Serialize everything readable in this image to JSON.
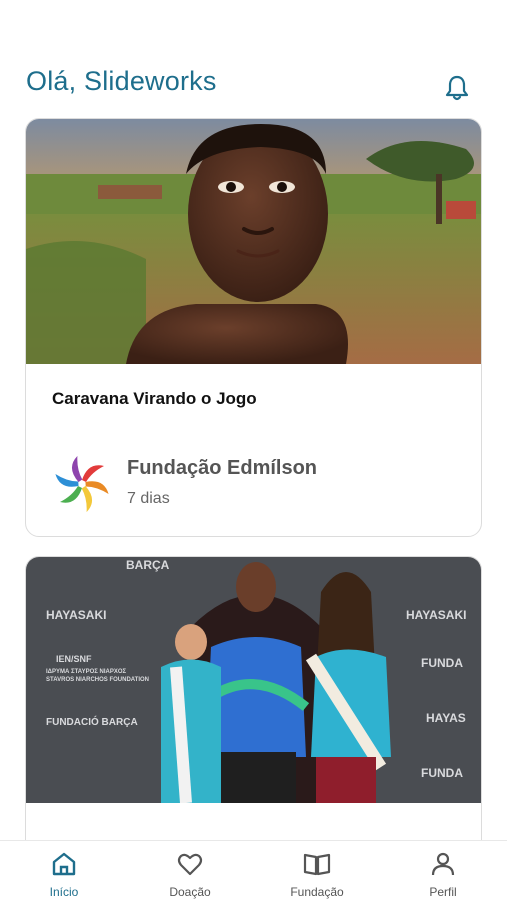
{
  "header": {
    "greeting": "Olá, Slideworks",
    "bell_icon": "bell-icon"
  },
  "feed": {
    "cards": [
      {
        "title": "Caravana Virando o Jogo",
        "organization": "Fundação Edmílson",
        "time_ago": "7 dias",
        "image": "photo-of-child-in-rural-field"
      },
      {
        "image": "photo-of-three-people-with-sashes-at-event-backdrop",
        "backdrop_texts": [
          "BARÇA",
          "HAYASAKI",
          "FUNDACIÓ BARÇA",
          "IEN/SNF",
          "ΙΔΡΥΜΑ ΣΤΑΥΡΟΣ ΝΙΑΡΧΟΣ",
          "STAVROS NIARCHOS FOUNDATION"
        ]
      }
    ]
  },
  "tabbar": {
    "items": [
      {
        "label": "Início",
        "icon": "home-icon",
        "active": true
      },
      {
        "label": "Doação",
        "icon": "heart-icon",
        "active": false
      },
      {
        "label": "Fundação",
        "icon": "book-icon",
        "active": false
      },
      {
        "label": "Perfil",
        "icon": "person-icon",
        "active": false
      }
    ]
  },
  "colors": {
    "accent": "#1e6e8c",
    "text_muted": "#555555",
    "card_border": "#dcdcdc"
  }
}
